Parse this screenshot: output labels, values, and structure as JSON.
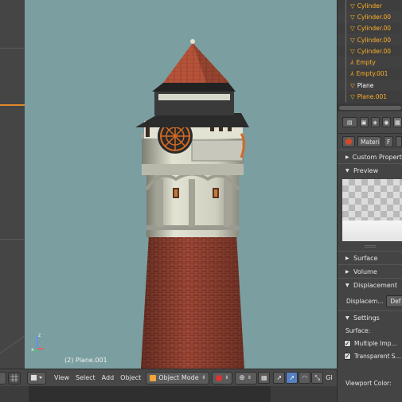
{
  "outliner": {
    "items": [
      {
        "label": "Cylinder",
        "icon": "cone-mesh-icon",
        "color": "#ffaf29"
      },
      {
        "label": "Cylinder.00",
        "icon": "cone-mesh-icon",
        "color": "#ffaf29"
      },
      {
        "label": "Cylinder.00",
        "icon": "cone-mesh-icon",
        "color": "#ffaf29"
      },
      {
        "label": "Cylinder.00",
        "icon": "cone-mesh-icon",
        "color": "#ffaf29"
      },
      {
        "label": "Cylinder.00",
        "icon": "cone-mesh-icon",
        "color": "#ffaf29"
      },
      {
        "label": "Empty",
        "icon": "empty-axes-icon",
        "color": "#ffaf29"
      },
      {
        "label": "Empty.001",
        "icon": "empty-axes-icon",
        "color": "#ffaf29"
      },
      {
        "label": "Plane",
        "icon": "cone-mesh-icon",
        "color": "#ffffff"
      },
      {
        "label": "Plane.001",
        "icon": "cone-mesh-icon",
        "color": "#ffaf29"
      }
    ]
  },
  "viewport": {
    "object_label": "(2) Plane.001",
    "background": "#7b9ea0"
  },
  "header3d": {
    "view": "View",
    "select": "Select",
    "add": "Add",
    "object": "Object",
    "mode": "Object Mode",
    "gl": "Gl"
  },
  "properties": {
    "material_name": "Materi",
    "fake_user": "F",
    "custom_properties": "Custom Properties",
    "preview": "Preview",
    "surface": "Surface",
    "volume": "Volume",
    "displacement": "Displacement",
    "displacement_field": "Displacem...",
    "displacement_value": "Def",
    "settings": "Settings",
    "surface_label": "Surface:",
    "multiple_importance": "Multiple Imp...",
    "transparent_shadows": "Transparent S...",
    "viewport_color": "Viewport Color:"
  },
  "colors": {
    "accent_orange": "#ffaf29",
    "active_blue": "#5680c2",
    "brick": "#8e3a2a",
    "roof": "#b5533a",
    "plaster": "#d6d6c4"
  }
}
